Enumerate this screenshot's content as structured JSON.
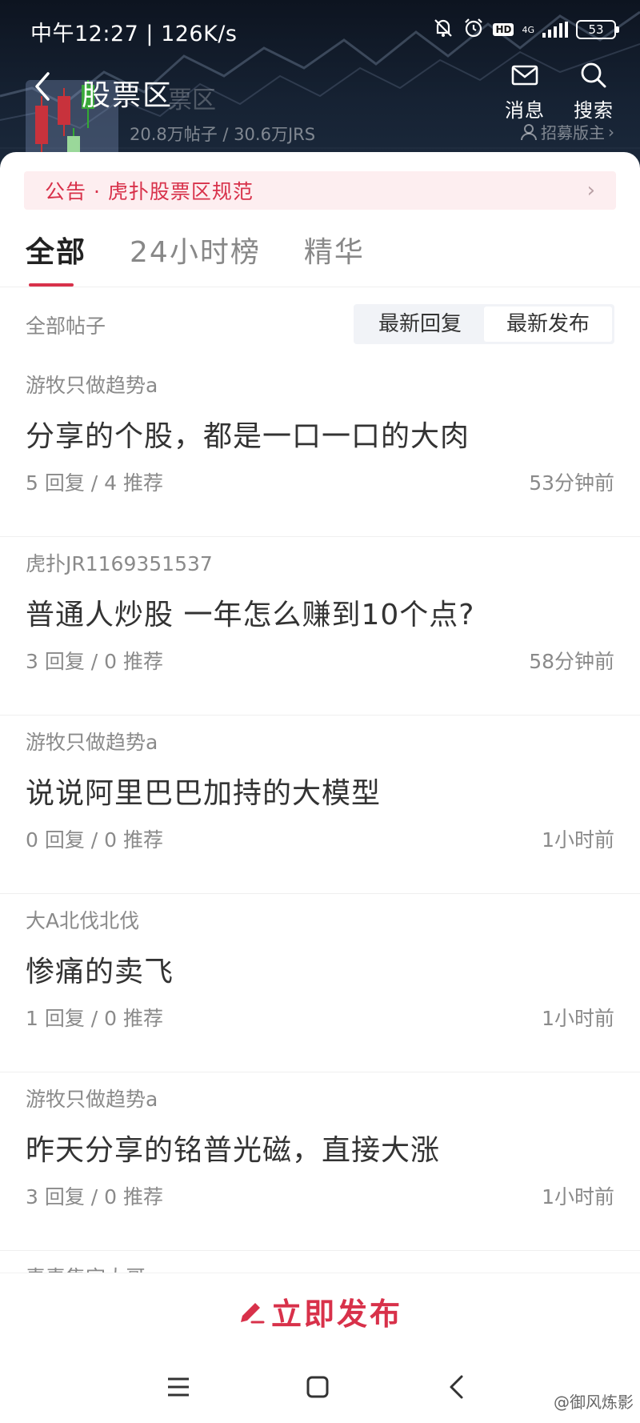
{
  "status_bar": {
    "time": "中午12:27 | 126K/s",
    "hd": "HD",
    "net": "4G",
    "battery": "53"
  },
  "header": {
    "back_icon": "chevron-left-icon",
    "title": "股票区",
    "ghost_title": "票区",
    "stats": "20.8万帖子 / 30.6万JRS",
    "message_label": "消息",
    "search_label": "搜索",
    "recruit_label": "招募版主"
  },
  "announcement": {
    "text": "公告 · 虎扑股票区规范",
    "arrow": "›"
  },
  "tabs": [
    {
      "label": "全部"
    },
    {
      "label": "24小时榜"
    },
    {
      "label": "精华"
    }
  ],
  "filter": {
    "label": "全部帖子",
    "sort_options": [
      {
        "label": "最新回复"
      },
      {
        "label": "最新发布"
      }
    ],
    "selected": "最新发布"
  },
  "posts": [
    {
      "author": "游牧只做趋势a",
      "title": "分享的个股，都是一口一口的大肉",
      "meta": "5 回复 / 4 推荐",
      "time": "53分钟前"
    },
    {
      "author": "虎扑JR1169351537",
      "title": "普通人炒股 一年怎么赚到10个点?",
      "meta": "3 回复 / 0 推荐",
      "time": "58分钟前"
    },
    {
      "author": "游牧只做趋势a",
      "title": "说说阿里巴巴加持的大模型",
      "meta": "0 回复 / 0 推荐",
      "time": "1小时前"
    },
    {
      "author": "大A北伐北伐",
      "title": "惨痛的卖飞",
      "meta": "1 回复 / 0 推荐",
      "time": "1小时前"
    },
    {
      "author": "游牧只做趋势a",
      "title": "昨天分享的铭普光磁，直接大涨",
      "meta": "3 回复 / 0 推荐",
      "time": "1小时前"
    }
  ],
  "partial_post": {
    "author": "素素集字大哥"
  },
  "publish": {
    "label": "立即发布",
    "icon": "pen-icon",
    "color": "#d8314a"
  },
  "watermark": {
    "text": "@御风炼影"
  }
}
